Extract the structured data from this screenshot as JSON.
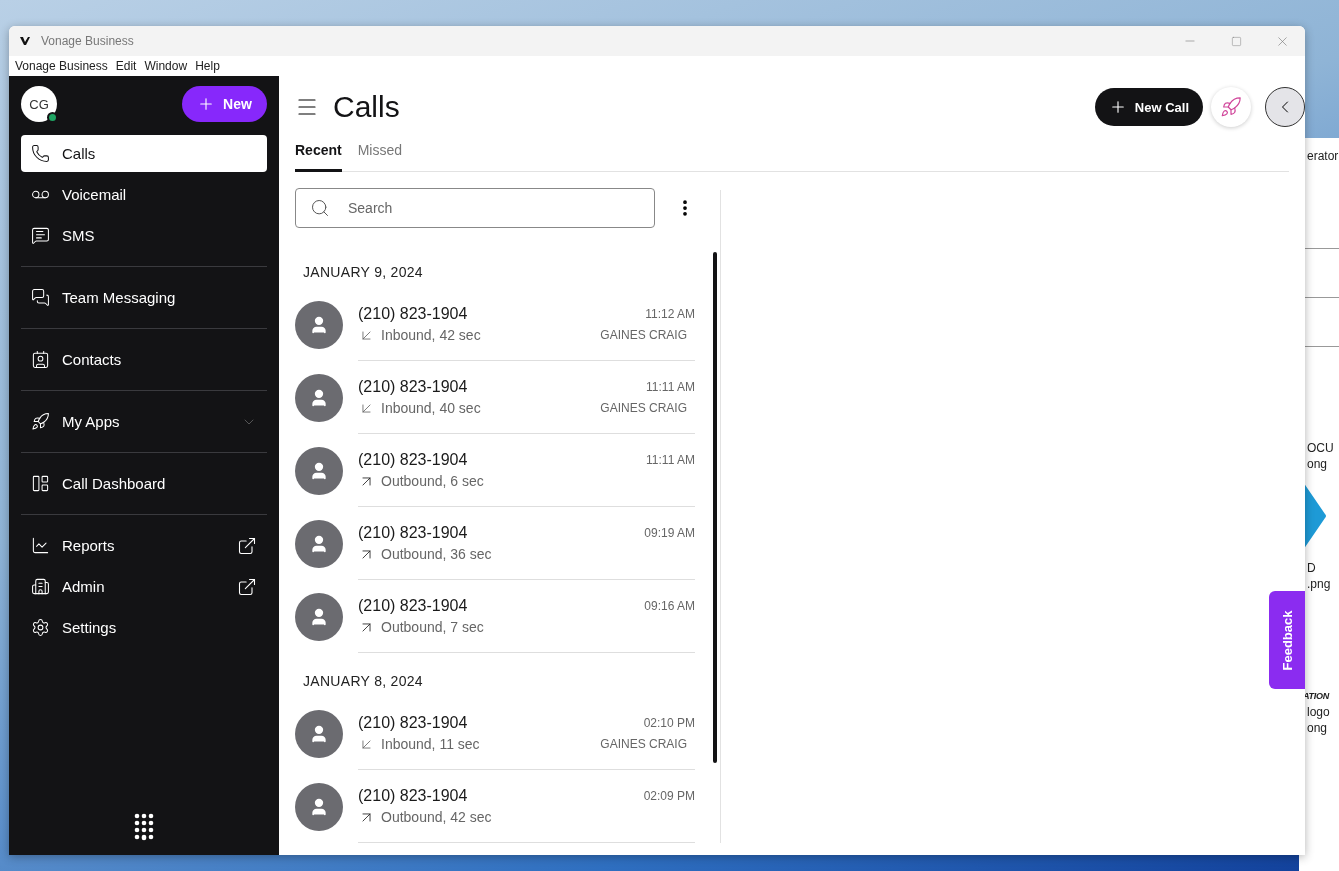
{
  "window": {
    "title": "Vonage Business"
  },
  "menu": [
    "Vonage Business",
    "Edit",
    "Window",
    "Help"
  ],
  "sidebar": {
    "avatar": {
      "initials": "CG",
      "color": "#1fa463"
    },
    "new_button": "New",
    "groups": [
      [
        {
          "label": "Calls",
          "selected": true,
          "kind": "link"
        },
        {
          "label": "Voicemail",
          "selected": false,
          "kind": "link"
        },
        {
          "label": "SMS",
          "selected": false,
          "kind": "link"
        }
      ],
      [
        {
          "label": "Team Messaging",
          "selected": false,
          "kind": "link"
        }
      ],
      [
        {
          "label": "Contacts",
          "selected": false,
          "kind": "link"
        }
      ],
      [
        {
          "label": "My Apps",
          "selected": false,
          "kind": "menu"
        }
      ],
      [
        {
          "label": "Call Dashboard",
          "selected": false,
          "kind": "link"
        }
      ],
      [
        {
          "label": "Reports",
          "selected": false,
          "kind": "external"
        },
        {
          "label": "Admin",
          "selected": false,
          "kind": "external"
        },
        {
          "label": "Settings",
          "selected": false,
          "kind": "link"
        }
      ]
    ]
  },
  "header": {
    "title": "Calls",
    "new_call_button": "New Call"
  },
  "tabs": [
    {
      "label": "Recent",
      "selected": true
    },
    {
      "label": "Missed",
      "selected": false
    }
  ],
  "search": {
    "placeholder": "Search"
  },
  "call_groups": [
    {
      "date": "JANUARY 9, 2024",
      "calls": [
        {
          "number": "(210) 823-1904",
          "time": "11:12 AM",
          "kind": "inbound",
          "summary": "Inbound, 42 sec",
          "name": "GAINES CRAIG"
        },
        {
          "number": "(210) 823-1904",
          "time": "11:11 AM",
          "kind": "inbound",
          "summary": "Inbound, 40 sec",
          "name": "GAINES CRAIG"
        },
        {
          "number": "(210) 823-1904",
          "time": "11:11 AM",
          "kind": "outbound",
          "summary": "Outbound, 6 sec"
        },
        {
          "number": "(210) 823-1904",
          "time": "09:19 AM",
          "kind": "outbound",
          "summary": "Outbound, 36 sec"
        },
        {
          "number": "(210) 823-1904",
          "time": "09:16 AM",
          "kind": "outbound",
          "summary": "Outbound, 7 sec"
        }
      ]
    },
    {
      "date": "JANUARY 8, 2024",
      "calls": [
        {
          "number": "(210) 823-1904",
          "time": "02:10 PM",
          "kind": "inbound",
          "summary": "Inbound, 11 sec",
          "name": "GAINES CRAIG"
        },
        {
          "number": "(210) 823-1904",
          "time": "02:09 PM",
          "kind": "outbound",
          "summary": "Outbound, 42 sec"
        }
      ]
    }
  ],
  "feedback_tab": "Feedback",
  "background_window": {
    "texts": [
      "erator",
      "OCU",
      "ong",
      "D",
      ".png",
      "ATION",
      "logo",
      "ong"
    ]
  }
}
